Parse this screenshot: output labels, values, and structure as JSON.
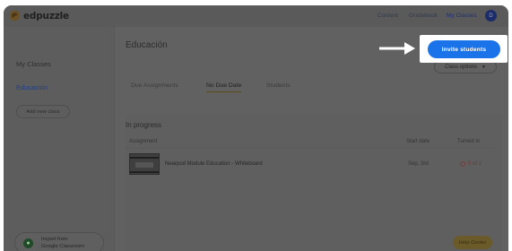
{
  "app": {
    "name": "edpuzzle"
  },
  "topnav": {
    "content": "Content",
    "gradebook": "Gradebook",
    "my_classes": "My Classes",
    "profile_initial": "D"
  },
  "sidebar": {
    "my_classes": "My Classes",
    "active_class": "Educación",
    "add_new_class": "Add new class",
    "import_line1": "Import from",
    "import_line2": "Google Classroom"
  },
  "main": {
    "title": "Educación",
    "class_options": "Class options",
    "tabs": [
      "Due Assignments",
      "No Due Date",
      "Students"
    ],
    "active_tab": "No Due Date",
    "section_title": "In progress",
    "columns": {
      "assignment": "Assignment",
      "start_date": "Start date",
      "turned_in": "Turned in"
    },
    "rows": [
      {
        "title": "Nearpod Module Education - Whiteboard",
        "start_date": "Sep, 3rd",
        "turned_in": "0 of 1"
      }
    ]
  },
  "callout": {
    "invite_label": "Invite students"
  },
  "help": {
    "label": "Help Center"
  },
  "colors": {
    "accent": "#1a73e8",
    "overlay": "#616161",
    "logo_orange": "#f2a533"
  }
}
